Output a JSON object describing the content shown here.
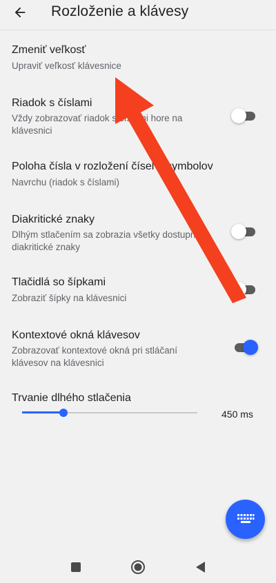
{
  "header": {
    "title": "Rozloženie a klávesy"
  },
  "settings": {
    "resize": {
      "title": "Zmeniť veľkosť",
      "subtitle": "Upraviť veľkosť klávesnice"
    },
    "number_row": {
      "title": "Riadok s číslami",
      "subtitle": "Vždy zobrazovať riadok s číslami hore na klávesnici",
      "enabled": false
    },
    "number_position": {
      "title": "Poloha čísla v rozložení čísel a symbolov",
      "subtitle": "Navrchu (riadok s číslami)"
    },
    "diacritics": {
      "title": "Diakritické znaky",
      "subtitle": "Dlhým stlačením sa zobrazia všetky dostupné diakritické znaky",
      "enabled": false
    },
    "arrow_keys": {
      "title": "Tlačidlá so šípkami",
      "subtitle": "Zobraziť šípky na klávesnici",
      "enabled": false
    },
    "key_popups": {
      "title": "Kontextové okná klávesov",
      "subtitle": "Zobrazovať kontextové okná pri stláčaní klávesov na klávesnici",
      "enabled": true
    },
    "long_press": {
      "title": "Trvanie dlhého stlačenia",
      "value_label": "450 ms",
      "fraction": 0.235
    }
  },
  "fab": {
    "icon": "keyboard-icon"
  },
  "navbar": {
    "icons": [
      "square-recents-icon",
      "circle-home-icon",
      "triangle-back-icon"
    ]
  },
  "annotation": {
    "icon": "red-arrow",
    "color": "#f4401f"
  },
  "colors": {
    "accent": "#2962ff",
    "background": "#f1f1f1"
  }
}
